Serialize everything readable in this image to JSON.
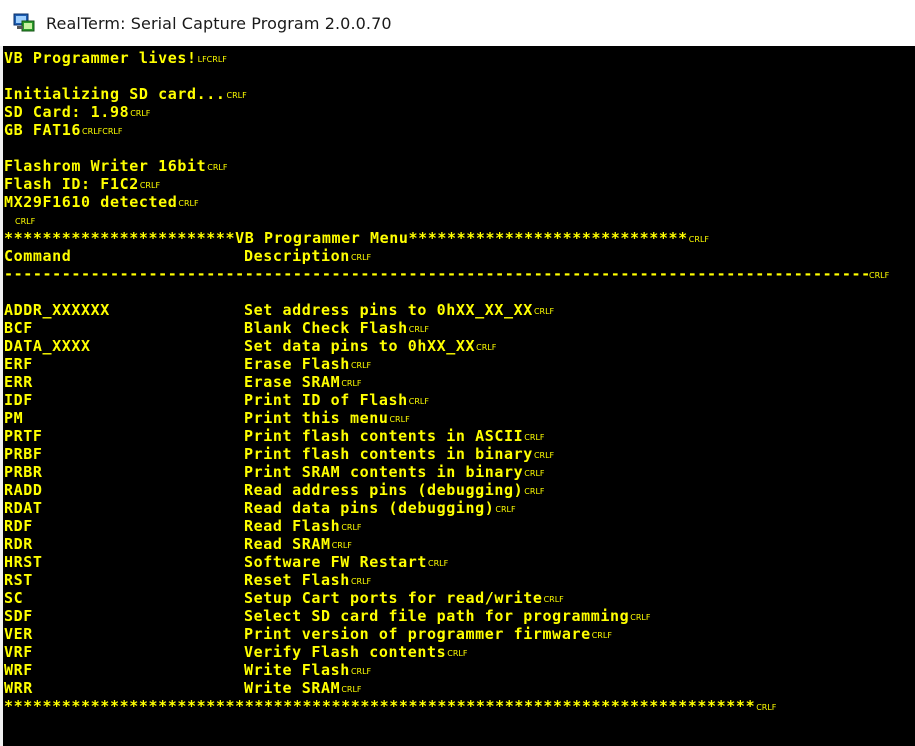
{
  "window": {
    "title": "RealTerm: Serial Capture Program 2.0.0.70",
    "icon": "realterm-app-icon"
  },
  "colors": {
    "terminal_bg": "#000000",
    "terminal_fg": "#ffff00"
  },
  "terminal": {
    "eol_marker": "CRLF",
    "lf_marker": "LF",
    "header_lines": [
      {
        "text": "VB Programmer lives!",
        "markers": "LFCRLF"
      },
      {
        "text": "",
        "markers": ""
      },
      {
        "text": "Initializing SD card...",
        "markers": "CRLF"
      },
      {
        "text": "SD Card: 1.98",
        "markers": "CRLF"
      },
      {
        "text": "GB FAT16",
        "markers": "CRLFCRLF"
      },
      {
        "text": "",
        "markers": ""
      },
      {
        "text": "Flashrom Writer 16bit",
        "markers": "CRLF"
      },
      {
        "text": "Flash ID: F1C2",
        "markers": "CRLF"
      },
      {
        "text": "MX29F1610 detected",
        "markers": "CRLF"
      },
      {
        "text": "",
        "markers": "CRLF"
      }
    ],
    "menu_banner": "************************VB Programmer Menu*****************************",
    "column_header": {
      "command": "Command",
      "description": "Description"
    },
    "separator": "--------------------------------------------------------------------------------------------------------",
    "menu_items": [
      {
        "command": "ADDR_XXXXXX",
        "description": "Set address pins to 0hXX_XX_XX"
      },
      {
        "command": "BCF",
        "description": "Blank Check Flash"
      },
      {
        "command": "DATA_XXXX",
        "description": "Set data pins to 0hXX_XX"
      },
      {
        "command": "ERF",
        "description": "Erase Flash"
      },
      {
        "command": "ERR",
        "description": "Erase SRAM"
      },
      {
        "command": "IDF",
        "description": "Print ID of Flash"
      },
      {
        "command": "PM",
        "description": "Print this menu"
      },
      {
        "command": "PRTF",
        "description": "Print flash contents in ASCII"
      },
      {
        "command": "PRBF",
        "description": "Print flash contents in binary"
      },
      {
        "command": "PRBR",
        "description": "Print SRAM contents in binary"
      },
      {
        "command": "RADD",
        "description": "Read address pins (debugging)"
      },
      {
        "command": "RDAT",
        "description": "Read data pins (debugging)"
      },
      {
        "command": "RDF",
        "description": "Read Flash"
      },
      {
        "command": "RDR",
        "description": "Read SRAM"
      },
      {
        "command": "HRST",
        "description": "Software FW Restart"
      },
      {
        "command": "RST",
        "description": "Reset Flash"
      },
      {
        "command": "SC",
        "description": "Setup Cart ports for read/write"
      },
      {
        "command": "SDF",
        "description": "Select SD card file path for programming"
      },
      {
        "command": "VER",
        "description": "Print version of programmer firmware"
      },
      {
        "command": "VRF",
        "description": "Verify Flash contents"
      },
      {
        "command": "WRF",
        "description": "Write Flash"
      },
      {
        "command": "WRR",
        "description": "Write SRAM"
      }
    ],
    "footer_banner": "******************************************************************************"
  }
}
